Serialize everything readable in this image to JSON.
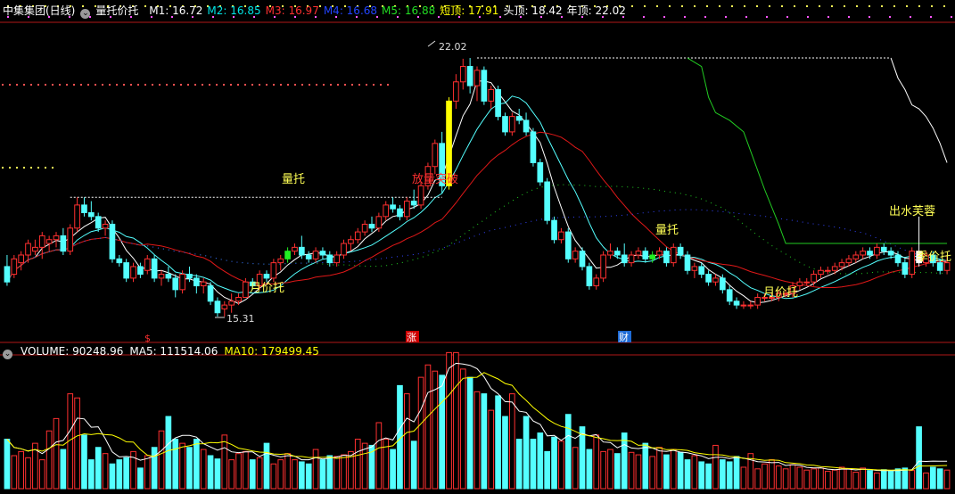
{
  "header": {
    "stock": "中集集团(日线)",
    "indicator": "量托价托",
    "values": [
      {
        "label": "M1:",
        "value": "16.72",
        "color": "#ffffff"
      },
      {
        "label": "M2:",
        "value": "16.85",
        "color": "#00e5e5"
      },
      {
        "label": "M3:",
        "value": "16.97",
        "color": "#ff3030"
      },
      {
        "label": "M4:",
        "value": "16.68",
        "color": "#2244ff"
      },
      {
        "label": "M5:",
        "value": "16.88",
        "color": "#22dd22"
      },
      {
        "label": "短顶:",
        "value": "17.91",
        "color": "#ffff00"
      },
      {
        "label": "头顶:",
        "value": "18.42",
        "color": "#ffffff"
      },
      {
        "label": "年顶:",
        "value": "22.02",
        "color": "#ffffff"
      }
    ]
  },
  "volume_header": {
    "items": [
      {
        "label": "VOLUME:",
        "value": "90248.96",
        "color": "#ffffff"
      },
      {
        "label": "MA5:",
        "value": "111514.06",
        "color": "#ffffff"
      },
      {
        "label": "MA10:",
        "value": "179499.45",
        "color": "#ffff00"
      }
    ]
  },
  "annotations": [
    {
      "id": "lt1",
      "text": "量托",
      "color": "#ffff55"
    },
    {
      "id": "yjt1",
      "text": "月价托",
      "color": "#ffff55"
    },
    {
      "id": "flt",
      "text": "放量突破",
      "color": "#ff3030"
    },
    {
      "id": "lt2",
      "text": "量托",
      "color": "#ffff55"
    },
    {
      "id": "yjt2",
      "text": "月价托",
      "color": "#ffff55"
    },
    {
      "id": "csfr",
      "text": "出水芙蓉",
      "color": "#ffff55"
    },
    {
      "id": "jjt",
      "text": "季价托",
      "color": "#ffff55"
    },
    {
      "id": "hi",
      "text": "22.02",
      "color": "#dddddd"
    },
    {
      "id": "lo",
      "text": "15.31",
      "color": "#dddddd"
    }
  ],
  "markers": [
    {
      "text": "$",
      "color": "#ff3030"
    },
    {
      "text": "涨",
      "color": "#ffffff",
      "bg": "#cc0000"
    },
    {
      "text": "财",
      "color": "#ffffff",
      "bg": "#1e6bd6"
    }
  ],
  "colors": {
    "up": "#ff3030",
    "down": "#54ffff",
    "bg": "#000000",
    "divider": "#b01818",
    "ma_white": "#ffffff",
    "ma_cyan": "#54ffff",
    "ma_red": "#e01818",
    "ma_green": "#22cc22",
    "ma_blue": "#3344ff"
  },
  "chart_data": {
    "type": "candlestick",
    "high_label": 22.02,
    "low_label": 15.31,
    "price_range": [
      15.0,
      22.6
    ],
    "candles": [
      {
        "o": 16.6,
        "h": 16.9,
        "l": 16.1,
        "c": 16.2
      },
      {
        "o": 16.4,
        "h": 16.9,
        "l": 16.3,
        "c": 16.8
      },
      {
        "o": 16.7,
        "h": 17.0,
        "l": 16.5,
        "c": 16.9
      },
      {
        "o": 16.9,
        "h": 17.3,
        "l": 16.7,
        "c": 17.2
      },
      {
        "o": 17.0,
        "h": 17.3,
        "l": 16.9,
        "c": 17.1
      },
      {
        "o": 17.1,
        "h": 17.5,
        "l": 16.8,
        "c": 17.4
      },
      {
        "o": 17.2,
        "h": 17.4,
        "l": 17.0,
        "c": 17.3
      },
      {
        "o": 17.3,
        "h": 17.5,
        "l": 17.1,
        "c": 17.4
      },
      {
        "o": 17.4,
        "h": 17.6,
        "l": 16.9,
        "c": 17.0
      },
      {
        "o": 17.0,
        "h": 17.7,
        "l": 16.9,
        "c": 17.6
      },
      {
        "o": 17.6,
        "h": 18.4,
        "l": 17.5,
        "c": 18.2
      },
      {
        "o": 18.2,
        "h": 18.4,
        "l": 17.9,
        "c": 18.0
      },
      {
        "o": 18.0,
        "h": 18.3,
        "l": 17.8,
        "c": 17.9
      },
      {
        "o": 17.9,
        "h": 18.0,
        "l": 17.5,
        "c": 17.6
      },
      {
        "o": 17.6,
        "h": 17.8,
        "l": 17.4,
        "c": 17.7
      },
      {
        "o": 17.7,
        "h": 17.8,
        "l": 16.7,
        "c": 16.8
      },
      {
        "o": 16.8,
        "h": 16.9,
        "l": 16.6,
        "c": 16.7
      },
      {
        "o": 16.7,
        "h": 16.8,
        "l": 16.2,
        "c": 16.3
      },
      {
        "o": 16.3,
        "h": 16.7,
        "l": 16.2,
        "c": 16.6
      },
      {
        "o": 16.6,
        "h": 16.7,
        "l": 16.3,
        "c": 16.4
      },
      {
        "o": 16.5,
        "h": 16.9,
        "l": 16.4,
        "c": 16.8
      },
      {
        "o": 16.8,
        "h": 16.9,
        "l": 16.2,
        "c": 16.3
      },
      {
        "o": 16.3,
        "h": 16.5,
        "l": 16.1,
        "c": 16.4
      },
      {
        "o": 16.4,
        "h": 16.6,
        "l": 16.2,
        "c": 16.3
      },
      {
        "o": 16.3,
        "h": 16.4,
        "l": 15.8,
        "c": 16.0
      },
      {
        "o": 16.0,
        "h": 16.5,
        "l": 15.9,
        "c": 16.4
      },
      {
        "o": 16.4,
        "h": 16.6,
        "l": 16.2,
        "c": 16.3
      },
      {
        "o": 16.3,
        "h": 16.4,
        "l": 15.9,
        "c": 16.1
      },
      {
        "o": 16.1,
        "h": 16.3,
        "l": 15.9,
        "c": 16.2
      },
      {
        "o": 16.1,
        "h": 16.2,
        "l": 15.6,
        "c": 15.7
      },
      {
        "o": 15.7,
        "h": 15.8,
        "l": 15.3,
        "c": 15.4
      },
      {
        "o": 15.5,
        "h": 15.7,
        "l": 15.3,
        "c": 15.6
      },
      {
        "o": 15.6,
        "h": 15.9,
        "l": 15.4,
        "c": 15.7
      },
      {
        "o": 15.7,
        "h": 15.9,
        "l": 15.6,
        "c": 15.8
      },
      {
        "o": 15.8,
        "h": 16.3,
        "l": 15.8,
        "c": 16.2
      },
      {
        "o": 16.2,
        "h": 16.3,
        "l": 16.0,
        "c": 16.1
      },
      {
        "o": 16.1,
        "h": 16.5,
        "l": 16.0,
        "c": 16.4
      },
      {
        "o": 16.4,
        "h": 16.5,
        "l": 16.2,
        "c": 16.3
      },
      {
        "o": 16.3,
        "h": 16.8,
        "l": 16.2,
        "c": 16.7
      },
      {
        "o": 16.7,
        "h": 16.9,
        "l": 16.5,
        "c": 16.8
      },
      {
        "o": 16.8,
        "h": 17.1,
        "l": 16.7,
        "c": 17.0
      },
      {
        "o": 17.0,
        "h": 17.2,
        "l": 16.9,
        "c": 17.1
      },
      {
        "o": 17.1,
        "h": 17.4,
        "l": 16.8,
        "c": 16.9
      },
      {
        "o": 16.9,
        "h": 17.0,
        "l": 16.7,
        "c": 16.8
      },
      {
        "o": 16.8,
        "h": 17.1,
        "l": 16.7,
        "c": 17.0
      },
      {
        "o": 17.0,
        "h": 17.1,
        "l": 16.8,
        "c": 16.9
      },
      {
        "o": 16.9,
        "h": 17.0,
        "l": 16.6,
        "c": 16.7
      },
      {
        "o": 16.7,
        "h": 17.0,
        "l": 16.6,
        "c": 16.9
      },
      {
        "o": 16.9,
        "h": 17.3,
        "l": 16.8,
        "c": 17.2
      },
      {
        "o": 17.2,
        "h": 17.4,
        "l": 17.0,
        "c": 17.3
      },
      {
        "o": 17.3,
        "h": 17.6,
        "l": 17.2,
        "c": 17.5
      },
      {
        "o": 17.5,
        "h": 17.8,
        "l": 17.4,
        "c": 17.7
      },
      {
        "o": 17.7,
        "h": 17.9,
        "l": 17.5,
        "c": 17.6
      },
      {
        "o": 17.6,
        "h": 18.0,
        "l": 17.5,
        "c": 17.9
      },
      {
        "o": 17.9,
        "h": 18.3,
        "l": 17.8,
        "c": 18.2
      },
      {
        "o": 18.2,
        "h": 18.4,
        "l": 18.0,
        "c": 18.1
      },
      {
        "o": 18.1,
        "h": 18.2,
        "l": 17.8,
        "c": 17.9
      },
      {
        "o": 17.9,
        "h": 18.4,
        "l": 17.8,
        "c": 18.3
      },
      {
        "o": 18.3,
        "h": 18.6,
        "l": 18.1,
        "c": 18.2
      },
      {
        "o": 18.2,
        "h": 18.8,
        "l": 18.1,
        "c": 18.7
      },
      {
        "o": 18.7,
        "h": 19.3,
        "l": 18.6,
        "c": 19.2
      },
      {
        "o": 19.2,
        "h": 19.9,
        "l": 19.0,
        "c": 19.8
      },
      {
        "o": 19.8,
        "h": 20.1,
        "l": 18.5,
        "c": 18.7
      },
      {
        "o": 18.7,
        "h": 21.0,
        "l": 18.6,
        "c": 20.9
      },
      {
        "o": 20.9,
        "h": 21.6,
        "l": 20.7,
        "c": 21.4
      },
      {
        "o": 21.4,
        "h": 22.0,
        "l": 21.2,
        "c": 21.8
      },
      {
        "o": 21.8,
        "h": 22.02,
        "l": 21.1,
        "c": 21.3
      },
      {
        "o": 21.3,
        "h": 21.8,
        "l": 20.9,
        "c": 21.7
      },
      {
        "o": 21.7,
        "h": 21.8,
        "l": 20.8,
        "c": 20.9
      },
      {
        "o": 20.9,
        "h": 21.3,
        "l": 20.7,
        "c": 21.2
      },
      {
        "o": 21.2,
        "h": 21.3,
        "l": 20.4,
        "c": 20.5
      },
      {
        "o": 20.5,
        "h": 20.6,
        "l": 20.0,
        "c": 20.1
      },
      {
        "o": 20.1,
        "h": 20.6,
        "l": 20.0,
        "c": 20.5
      },
      {
        "o": 20.5,
        "h": 20.7,
        "l": 20.3,
        "c": 20.4
      },
      {
        "o": 20.4,
        "h": 20.6,
        "l": 20.0,
        "c": 20.1
      },
      {
        "o": 20.1,
        "h": 20.2,
        "l": 19.2,
        "c": 19.3
      },
      {
        "o": 19.3,
        "h": 19.4,
        "l": 18.7,
        "c": 18.8
      },
      {
        "o": 18.8,
        "h": 18.9,
        "l": 17.7,
        "c": 17.8
      },
      {
        "o": 17.8,
        "h": 17.9,
        "l": 17.2,
        "c": 17.3
      },
      {
        "o": 17.3,
        "h": 17.6,
        "l": 17.2,
        "c": 17.5
      },
      {
        "o": 17.5,
        "h": 17.6,
        "l": 16.7,
        "c": 16.8
      },
      {
        "o": 16.8,
        "h": 17.1,
        "l": 16.7,
        "c": 17.0
      },
      {
        "o": 17.0,
        "h": 17.1,
        "l": 16.5,
        "c": 16.6
      },
      {
        "o": 16.6,
        "h": 16.7,
        "l": 16.0,
        "c": 16.1
      },
      {
        "o": 16.1,
        "h": 16.4,
        "l": 16.0,
        "c": 16.3
      },
      {
        "o": 16.3,
        "h": 17.0,
        "l": 16.2,
        "c": 16.9
      },
      {
        "o": 16.9,
        "h": 17.2,
        "l": 16.8,
        "c": 17.0
      },
      {
        "o": 17.0,
        "h": 17.1,
        "l": 16.8,
        "c": 16.9
      },
      {
        "o": 16.9,
        "h": 17.2,
        "l": 16.6,
        "c": 16.7
      },
      {
        "o": 16.7,
        "h": 17.0,
        "l": 16.6,
        "c": 16.9
      },
      {
        "o": 16.9,
        "h": 17.1,
        "l": 16.8,
        "c": 17.0
      },
      {
        "o": 17.0,
        "h": 17.1,
        "l": 16.7,
        "c": 16.8
      },
      {
        "o": 16.8,
        "h": 17.0,
        "l": 16.7,
        "c": 16.9
      },
      {
        "o": 16.9,
        "h": 17.1,
        "l": 16.8,
        "c": 17.0
      },
      {
        "o": 17.0,
        "h": 17.1,
        "l": 16.6,
        "c": 16.7
      },
      {
        "o": 16.7,
        "h": 17.2,
        "l": 16.6,
        "c": 17.1
      },
      {
        "o": 17.1,
        "h": 17.2,
        "l": 16.8,
        "c": 16.9
      },
      {
        "o": 16.9,
        "h": 17.0,
        "l": 16.4,
        "c": 16.5
      },
      {
        "o": 16.5,
        "h": 16.7,
        "l": 16.3,
        "c": 16.6
      },
      {
        "o": 16.6,
        "h": 16.7,
        "l": 16.3,
        "c": 16.4
      },
      {
        "o": 16.4,
        "h": 16.5,
        "l": 16.1,
        "c": 16.2
      },
      {
        "o": 16.2,
        "h": 16.4,
        "l": 16.1,
        "c": 16.3
      },
      {
        "o": 16.3,
        "h": 16.4,
        "l": 15.9,
        "c": 16.0
      },
      {
        "o": 16.0,
        "h": 16.1,
        "l": 15.6,
        "c": 15.7
      },
      {
        "o": 15.7,
        "h": 15.8,
        "l": 15.5,
        "c": 15.6
      },
      {
        "o": 15.6,
        "h": 15.7,
        "l": 15.5,
        "c": 15.6
      },
      {
        "o": 15.6,
        "h": 15.7,
        "l": 15.5,
        "c": 15.6
      },
      {
        "o": 15.6,
        "h": 15.9,
        "l": 15.5,
        "c": 15.8
      },
      {
        "o": 15.8,
        "h": 15.9,
        "l": 15.7,
        "c": 15.8
      },
      {
        "o": 15.8,
        "h": 15.9,
        "l": 15.7,
        "c": 15.8
      },
      {
        "o": 15.8,
        "h": 16.0,
        "l": 15.7,
        "c": 15.9
      },
      {
        "o": 15.9,
        "h": 16.0,
        "l": 15.8,
        "c": 15.9
      },
      {
        "o": 15.9,
        "h": 16.2,
        "l": 15.8,
        "c": 16.1
      },
      {
        "o": 16.1,
        "h": 16.3,
        "l": 16.0,
        "c": 16.2
      },
      {
        "o": 16.2,
        "h": 16.3,
        "l": 16.1,
        "c": 16.2
      },
      {
        "o": 16.2,
        "h": 16.5,
        "l": 16.1,
        "c": 16.4
      },
      {
        "o": 16.4,
        "h": 16.6,
        "l": 16.3,
        "c": 16.5
      },
      {
        "o": 16.5,
        "h": 16.6,
        "l": 16.4,
        "c": 16.5
      },
      {
        "o": 16.5,
        "h": 16.7,
        "l": 16.4,
        "c": 16.6
      },
      {
        "o": 16.6,
        "h": 16.8,
        "l": 16.5,
        "c": 16.7
      },
      {
        "o": 16.7,
        "h": 16.9,
        "l": 16.6,
        "c": 16.8
      },
      {
        "o": 16.8,
        "h": 17.0,
        "l": 16.7,
        "c": 16.9
      },
      {
        "o": 16.9,
        "h": 17.1,
        "l": 16.8,
        "c": 17.0
      },
      {
        "o": 17.0,
        "h": 17.1,
        "l": 16.8,
        "c": 16.9
      },
      {
        "o": 16.9,
        "h": 17.2,
        "l": 16.8,
        "c": 17.1
      },
      {
        "o": 17.1,
        "h": 17.2,
        "l": 16.9,
        "c": 17.0
      },
      {
        "o": 17.0,
        "h": 17.1,
        "l": 16.8,
        "c": 16.9
      },
      {
        "o": 16.9,
        "h": 17.0,
        "l": 16.6,
        "c": 16.7
      },
      {
        "o": 16.7,
        "h": 16.8,
        "l": 16.3,
        "c": 16.4
      },
      {
        "o": 16.4,
        "h": 17.1,
        "l": 16.3,
        "c": 17.0
      },
      {
        "o": 17.0,
        "h": 17.9,
        "l": 16.6,
        "c": 16.7
      },
      {
        "o": 16.7,
        "h": 17.0,
        "l": 16.6,
        "c": 16.9
      },
      {
        "o": 16.9,
        "h": 17.0,
        "l": 16.6,
        "c": 16.7
      },
      {
        "o": 16.7,
        "h": 16.8,
        "l": 16.4,
        "c": 16.5
      },
      {
        "o": 16.5,
        "h": 16.9,
        "l": 16.4,
        "c": 16.7
      }
    ],
    "volume": {
      "ma5_last": 111514.06,
      "ma10_last": 179499.45,
      "last": 90248.96,
      "range": [
        0,
        320000
      ],
      "values": [
        120000,
        80000,
        90000,
        75000,
        110000,
        70000,
        140000,
        170000,
        95000,
        230000,
        220000,
        130000,
        70000,
        100000,
        85000,
        60000,
        70000,
        75000,
        90000,
        50000,
        80000,
        100000,
        140000,
        175000,
        120000,
        110000,
        100000,
        120000,
        95000,
        80000,
        72000,
        130000,
        70000,
        85000,
        90000,
        70000,
        75000,
        110000,
        60000,
        70000,
        85000,
        70000,
        65000,
        60000,
        95000,
        70000,
        80000,
        78000,
        82000,
        90000,
        120000,
        110000,
        105000,
        160000,
        120000,
        95000,
        250000,
        230000,
        115000,
        270000,
        300000,
        285000,
        275000,
        330000,
        330000,
        290000,
        270000,
        235000,
        230000,
        190000,
        225000,
        175000,
        230000,
        120000,
        175000,
        120000,
        135000,
        90000,
        125000,
        115000,
        180000,
        100000,
        150000,
        95000,
        130000,
        90000,
        95000,
        85000,
        135000,
        88000,
        82000,
        110000,
        78000,
        100000,
        82000,
        95000,
        88000,
        70000,
        80000,
        65000,
        60000,
        105000,
        70000,
        65000,
        78000,
        52000,
        85000,
        48000,
        60000,
        70000,
        55000,
        48000,
        58000,
        52000,
        45000,
        48000,
        50000,
        42000,
        45000,
        52000,
        48000,
        40000,
        50000,
        44000,
        38000,
        46000,
        42000,
        48000,
        50000,
        44000,
        150000,
        38000,
        52000,
        48000,
        45000,
        42000,
        90000,
        40000
      ]
    }
  }
}
